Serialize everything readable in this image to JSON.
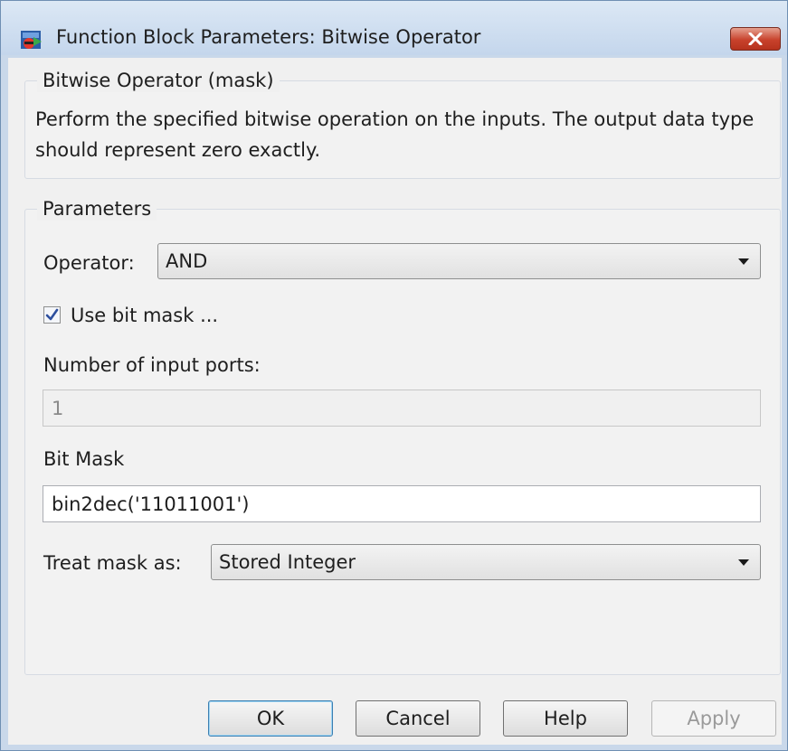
{
  "window": {
    "title": "Function Block Parameters: Bitwise Operator"
  },
  "mask_group": {
    "title": "Bitwise Operator (mask)",
    "description": "Perform the specified bitwise operation on the inputs. The output data type should represent zero exactly."
  },
  "params": {
    "title": "Parameters",
    "operator_label": "Operator:",
    "operator_value": "AND",
    "use_bit_mask_label": "Use bit mask ...",
    "use_bit_mask_checked": true,
    "num_ports_label": "Number of input ports:",
    "num_ports_value": "1",
    "bit_mask_label": "Bit Mask",
    "bit_mask_value": "bin2dec('11011001')",
    "treat_mask_label": "Treat mask as:",
    "treat_mask_value": "Stored Integer"
  },
  "buttons": {
    "ok": "OK",
    "cancel": "Cancel",
    "help": "Help",
    "apply": "Apply"
  },
  "colors": {
    "close_red": "#c8422c",
    "title_bg": "#c9d8ea",
    "check_blue": "#2d4f9e"
  }
}
